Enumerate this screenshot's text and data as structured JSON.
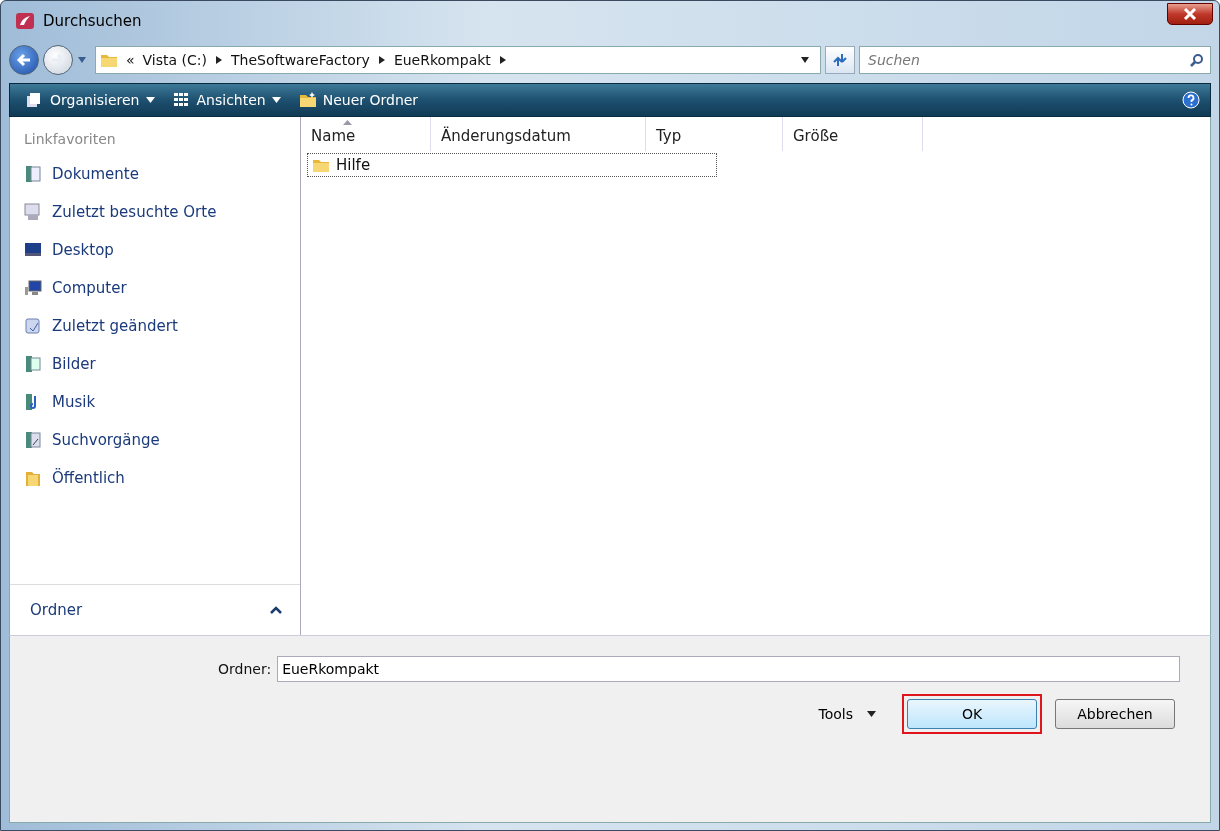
{
  "window": {
    "title": "Durchsuchen"
  },
  "address_bar": {
    "overflow": "«",
    "segments": [
      "Vista (C:)",
      "TheSoftwareFactory",
      "EueRkompakt"
    ]
  },
  "search": {
    "placeholder": "Suchen"
  },
  "toolbar": {
    "items": [
      {
        "label": "Organisieren",
        "dropdown": true
      },
      {
        "label": "Ansichten",
        "dropdown": true
      },
      {
        "label": "Neuer Ordner",
        "dropdown": false
      }
    ]
  },
  "sidebar": {
    "heading": "Linkfavoriten",
    "items": [
      {
        "label": "Dokumente"
      },
      {
        "label": "Zuletzt besuchte Orte"
      },
      {
        "label": "Desktop"
      },
      {
        "label": "Computer"
      },
      {
        "label": "Zuletzt geändert"
      },
      {
        "label": "Bilder"
      },
      {
        "label": "Musik"
      },
      {
        "label": "Suchvorgänge"
      },
      {
        "label": "Öffentlich"
      }
    ],
    "folders_toggle": {
      "label": "Ordner",
      "expanded": false
    }
  },
  "file_list": {
    "columns": [
      {
        "label": "Name",
        "sorted": true
      },
      {
        "label": "Änderungsdatum",
        "sorted": false
      },
      {
        "label": "Typ",
        "sorted": false
      },
      {
        "label": "Größe",
        "sorted": false
      }
    ],
    "rows": [
      {
        "name": "Hilfe",
        "focused": true
      }
    ]
  },
  "folder_field": {
    "label": "Ordner:",
    "value": "EueRkompakt"
  },
  "tools": {
    "label": "Tools"
  },
  "buttons": [
    {
      "label": "OK",
      "highlighted": true
    },
    {
      "label": "Abbrechen",
      "highlighted": false
    }
  ]
}
